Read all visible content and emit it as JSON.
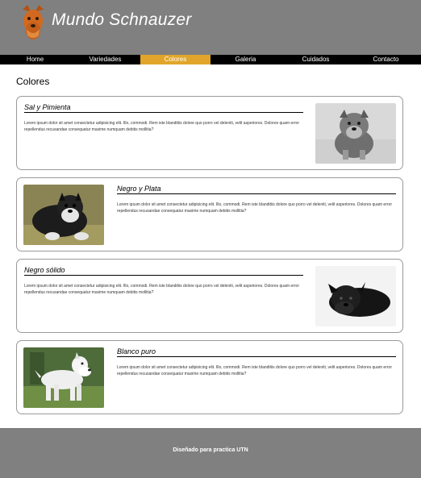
{
  "site": {
    "title": "Mundo Schnauzer"
  },
  "nav": {
    "items": [
      {
        "label": "Home"
      },
      {
        "label": "Variedades"
      },
      {
        "label": "Colores"
      },
      {
        "label": "Galeria"
      },
      {
        "label": "Cuidados"
      },
      {
        "label": "Contacto"
      }
    ],
    "active_index": 2,
    "active_color": "#e0a52a"
  },
  "page": {
    "title": "Colores"
  },
  "cards": [
    {
      "title": "Sal y Pimienta",
      "text": "Lorem ipsum dolor sit amet consectetur adipisicing elit. Illo, commodi. Rem iste blanditiis dolore quo porro vel deleniti, velit asperiores. Dolores quam error repellendus recusandae consequatur maxime numquam debitis mollitia?",
      "image": "schnauzer-salt-pepper-puppy"
    },
    {
      "title": "Negro y Plata",
      "text": "Lorem ipsum dolor sit amet consectetur adipisicing elit. Illo, commodi. Rem iste blanditiis dolore quo porro vel deleniti, velit asperiores. Dolores quam error repellendus recusandae consequatur maxime numquam debitis mollitia?",
      "image": "schnauzer-black-silver"
    },
    {
      "title": "Negro sólido",
      "text": "Lorem ipsum dolor sit amet consectetur adipisicing elit. Illo, commodi. Rem iste blanditiis dolore quo porro vel deleniti, velit asperiores. Dolores quam error repellendus recusandae consequatur maxime numquam debitis mollitia?",
      "image": "schnauzer-solid-black"
    },
    {
      "title": "Blanco puro",
      "text": "Lorem ipsum dolor sit amet consectetur adipisicing elit. Illo, commodi. Rem iste blanditiis dolore quo porro vel deleniti, velit asperiores. Dolores quam error repellendus recusandae consequatur maxime numquam debitis mollitia?",
      "image": "schnauzer-pure-white"
    }
  ],
  "footer": {
    "text": "Diseñado para practica UTN"
  }
}
